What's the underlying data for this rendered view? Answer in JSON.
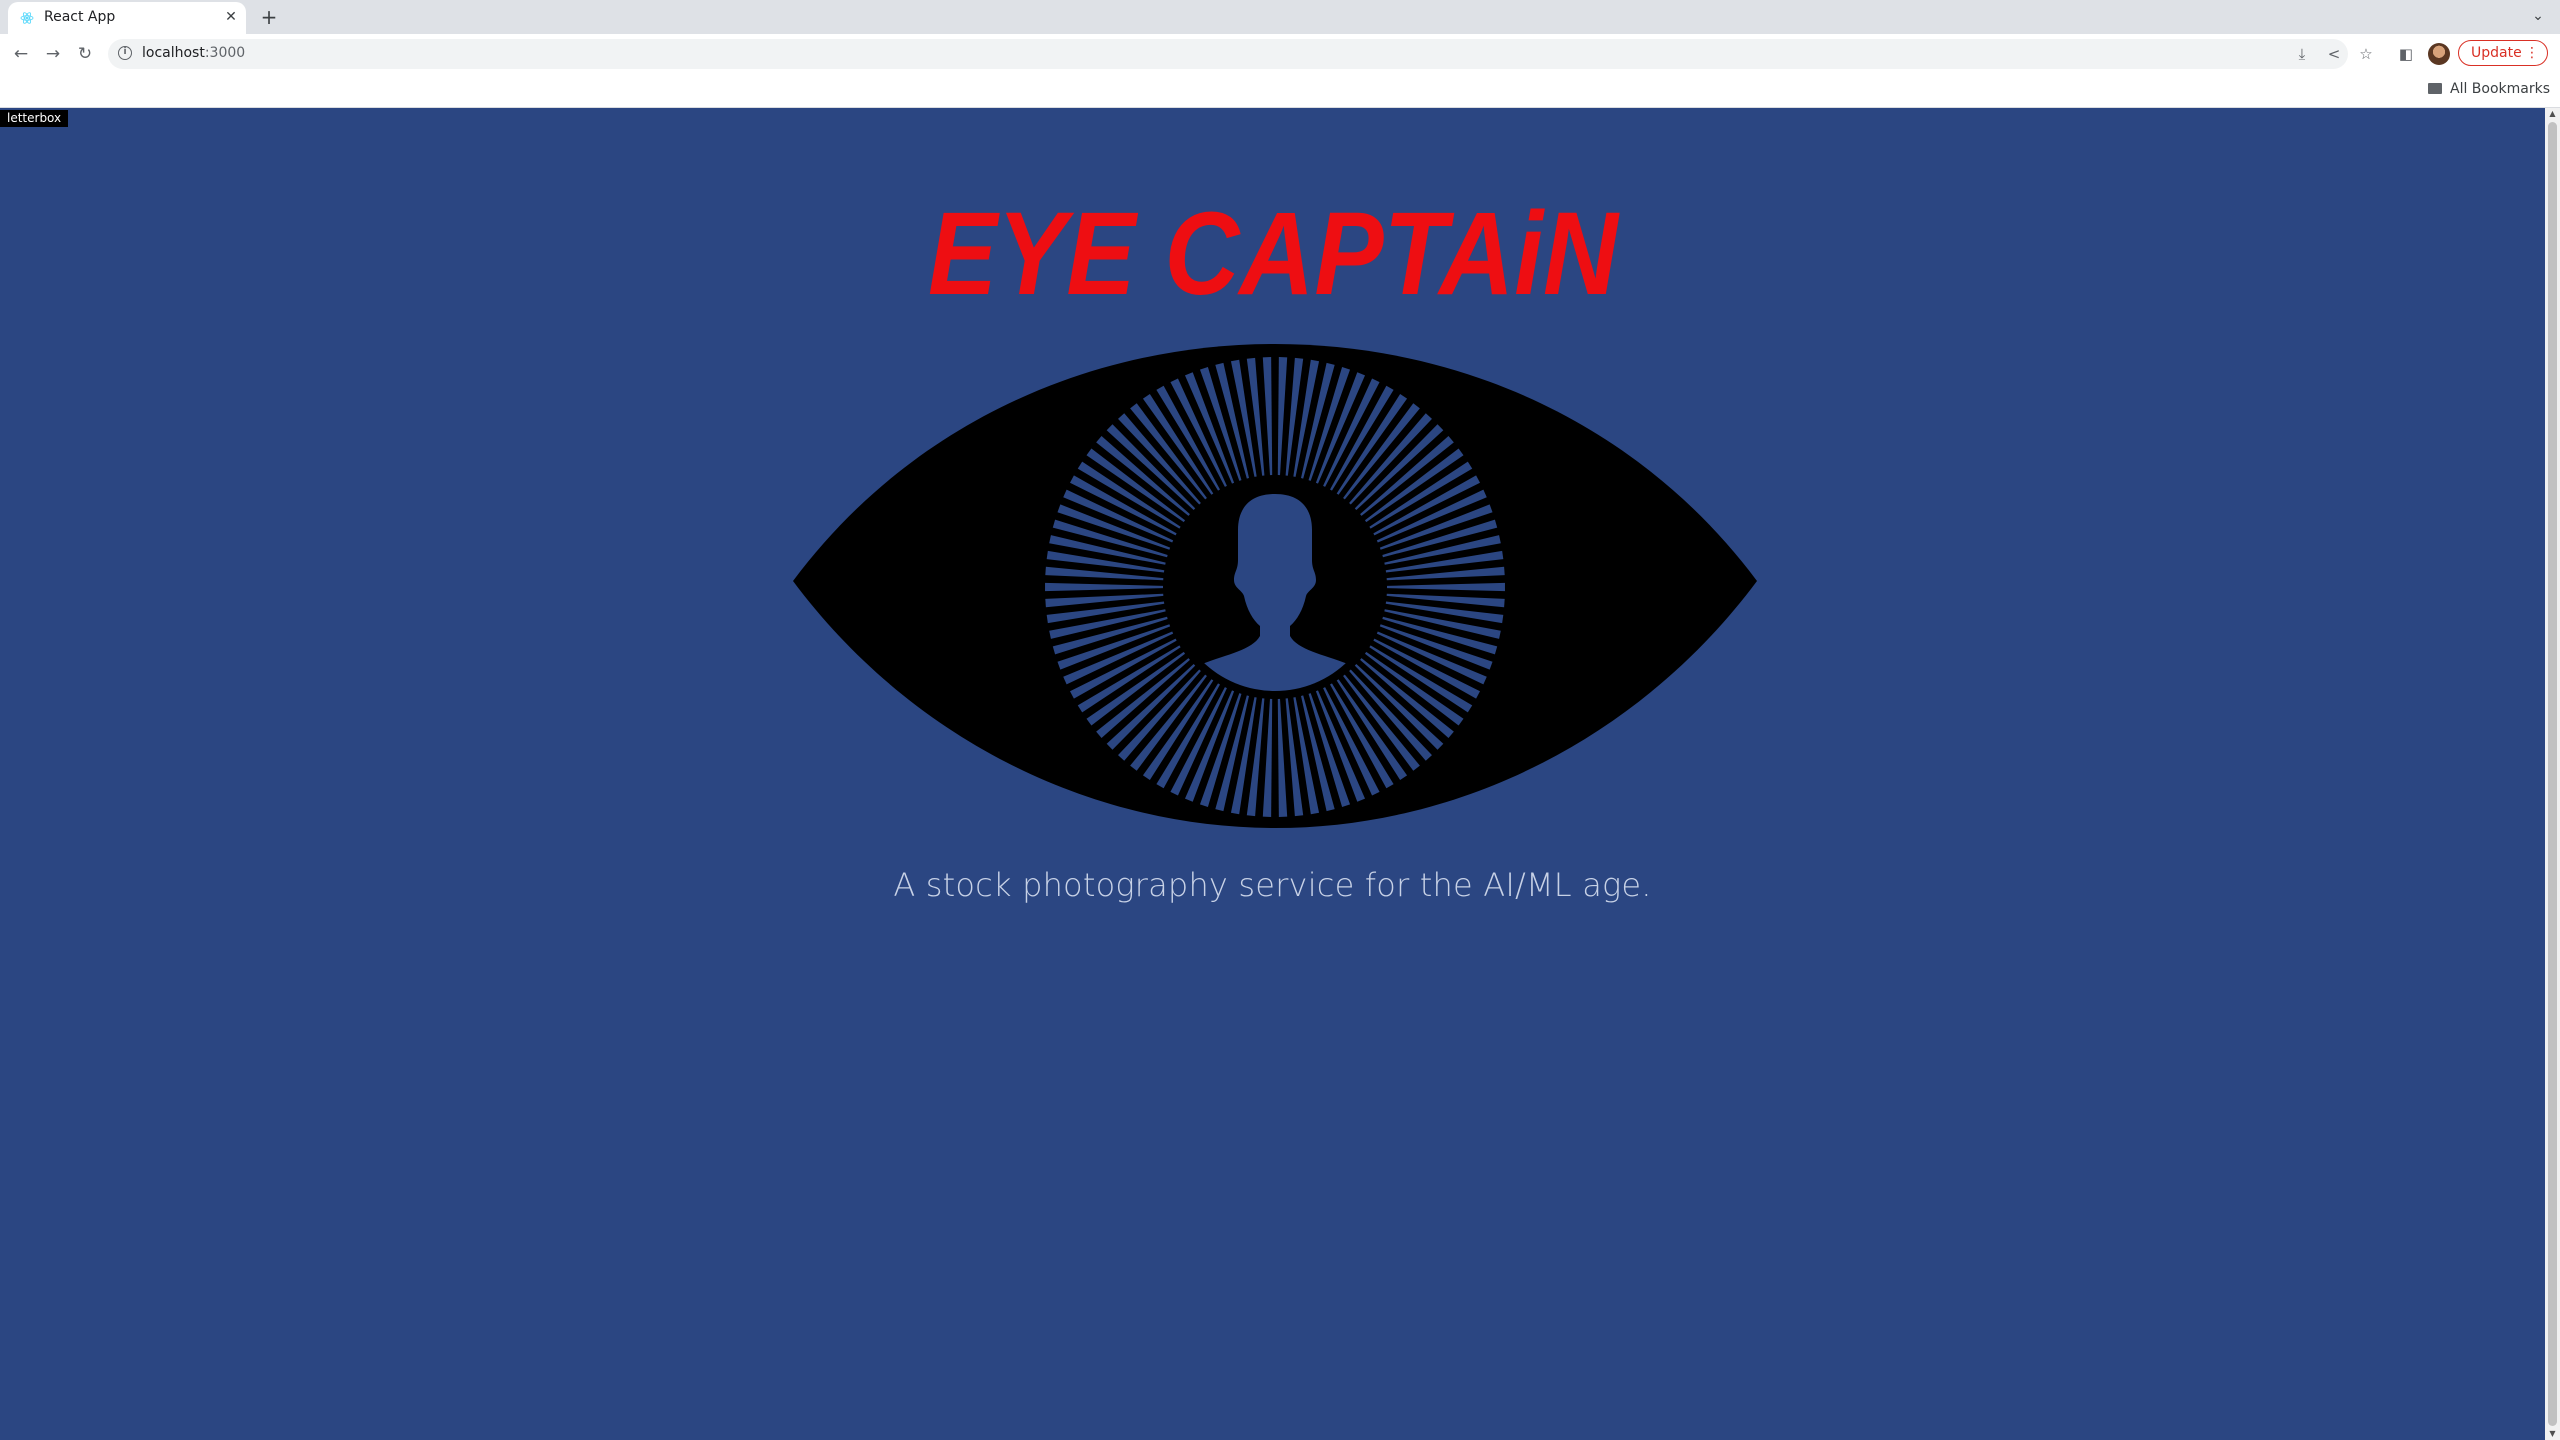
{
  "browser": {
    "tab_title": "React App",
    "tab_close_icon": "close-icon",
    "new_tab_icon": "plus-icon",
    "url_host": "localhost",
    "url_port": ":3000",
    "update_label": "Update",
    "bookmarks_label": "All Bookmarks"
  },
  "page": {
    "letterbox_label": "letterbox",
    "brand_title": "EYE CAPTAiN",
    "tagline": "A stock photography service for the AI/ML age."
  },
  "colors": {
    "page_background": "#2b4682",
    "brand_red": "#ee0e12",
    "eye_black": "#000000",
    "tagline_color": "#c7d1e6",
    "update_red": "#d93025"
  }
}
